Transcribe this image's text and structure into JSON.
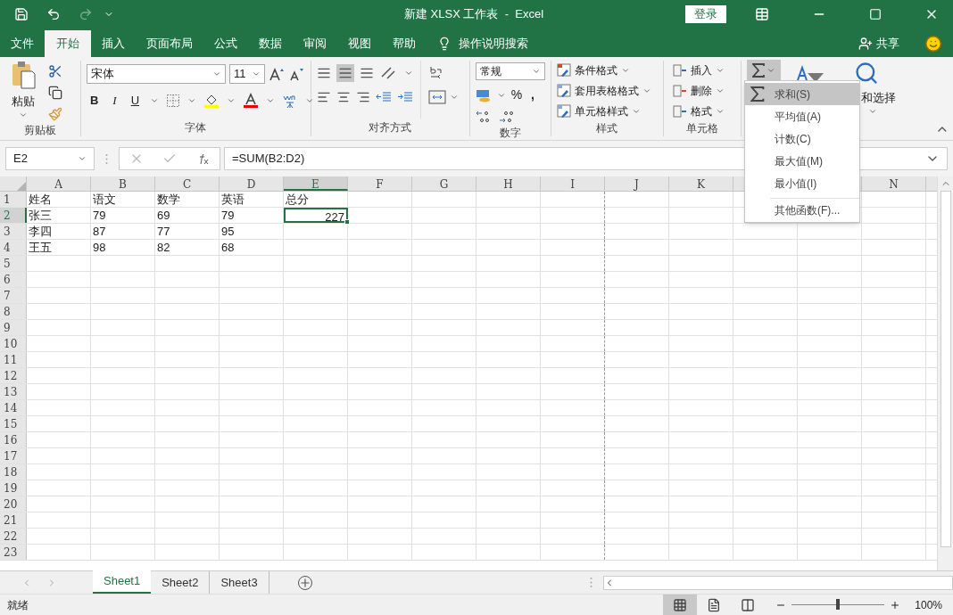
{
  "title_bar": {
    "title": "新建 XLSX 工作表  -  Excel",
    "login_button": "登录"
  },
  "menu_tabs": [
    {
      "label": "文件",
      "selected": false
    },
    {
      "label": "开始",
      "selected": true
    },
    {
      "label": "插入",
      "selected": false
    },
    {
      "label": "页面布局",
      "selected": false
    },
    {
      "label": "公式",
      "selected": false
    },
    {
      "label": "数据",
      "selected": false
    },
    {
      "label": "审阅",
      "selected": false
    },
    {
      "label": "视图",
      "selected": false
    },
    {
      "label": "帮助",
      "selected": false
    }
  ],
  "tell_me": "操作说明搜索",
  "share": "共享",
  "ribbon": {
    "clipboard": {
      "paste": "粘贴",
      "label": "剪贴板"
    },
    "font": {
      "name": "宋体",
      "size": "11",
      "bold": "B",
      "italic": "I",
      "underline": "U",
      "label": "字体"
    },
    "alignment": {
      "label": "对齐方式"
    },
    "number": {
      "format": "常规",
      "percent": "%",
      "comma": ",",
      "label": "数字"
    },
    "styles": {
      "items": [
        "条件格式",
        "套用表格格式",
        "单元格样式"
      ],
      "label": "样式"
    },
    "cells": {
      "items": [
        "插入",
        "删除",
        "格式"
      ],
      "label": "单元格"
    },
    "editing": {
      "find": "和选择",
      "sum_open": true
    }
  },
  "sum_menu": [
    {
      "label": "求和(S)",
      "selected": true,
      "kind": "sum"
    },
    {
      "label": "平均值(A)",
      "selected": false,
      "kind": "plain"
    },
    {
      "label": "计数(C)",
      "selected": false,
      "kind": "plain"
    },
    {
      "label": "最大值(M)",
      "selected": false,
      "kind": "plain"
    },
    {
      "label": "最小值(I)",
      "selected": false,
      "kind": "plain"
    },
    {
      "label": "其他函数(F)...",
      "selected": false,
      "kind": "more"
    }
  ],
  "formula_bar": {
    "name_box": "E2",
    "formula": "=SUM(B2:D2)"
  },
  "sheet": {
    "columns": [
      {
        "label": "A",
        "selected": false
      },
      {
        "label": "B",
        "selected": false
      },
      {
        "label": "C",
        "selected": false
      },
      {
        "label": "D",
        "selected": false
      },
      {
        "label": "E",
        "selected": true
      },
      {
        "label": "F",
        "selected": false
      },
      {
        "label": "G",
        "selected": false
      },
      {
        "label": "H",
        "selected": false
      },
      {
        "label": "I",
        "selected": false
      },
      {
        "label": "J",
        "selected": false
      },
      {
        "label": "K",
        "selected": false
      },
      null,
      null,
      {
        "label": "N",
        "selected": false
      }
    ],
    "rows": [
      {
        "header": "1",
        "selected": false,
        "cells": [
          {
            "text": "姓名",
            "kind": "text"
          },
          {
            "text": "语文",
            "kind": "text"
          },
          {
            "text": "数学",
            "kind": "text"
          },
          {
            "text": "英语",
            "kind": "text"
          },
          {
            "text": "总分",
            "kind": "text"
          }
        ]
      },
      {
        "header": "2",
        "selected": true,
        "cells": [
          {
            "text": "张三",
            "kind": "text"
          },
          {
            "text": "79",
            "kind": "text"
          },
          {
            "text": "69",
            "kind": "text"
          },
          {
            "text": "79",
            "kind": "text"
          },
          {
            "text": "227",
            "kind": "number"
          }
        ]
      },
      {
        "header": "3",
        "selected": false,
        "cells": [
          {
            "text": "李四",
            "kind": "text"
          },
          {
            "text": "87",
            "kind": "text"
          },
          {
            "text": "77",
            "kind": "text"
          },
          {
            "text": "95",
            "kind": "text"
          }
        ]
      },
      {
        "header": "4",
        "selected": false,
        "cells": [
          {
            "text": "王五",
            "kind": "text"
          },
          {
            "text": "98",
            "kind": "text"
          },
          {
            "text": "82",
            "kind": "text"
          },
          {
            "text": "68",
            "kind": "text"
          }
        ]
      },
      {
        "header": "5",
        "selected": false
      },
      {
        "header": "6",
        "selected": false
      },
      {
        "header": "7",
        "selected": false
      },
      {
        "header": "8",
        "selected": false
      },
      {
        "header": "9",
        "selected": false
      },
      {
        "header": "10",
        "selected": false
      },
      {
        "header": "11",
        "selected": false
      },
      {
        "header": "12",
        "selected": false
      },
      {
        "header": "13",
        "selected": false
      },
      {
        "header": "14",
        "selected": false
      },
      {
        "header": "15",
        "selected": false
      },
      {
        "header": "16",
        "selected": false
      },
      {
        "header": "17",
        "selected": false
      },
      {
        "header": "18",
        "selected": false
      },
      {
        "header": "19",
        "selected": false
      },
      {
        "header": "20",
        "selected": false
      },
      {
        "header": "21",
        "selected": false
      },
      {
        "header": "22",
        "selected": false
      },
      {
        "header": "23",
        "selected": false
      }
    ]
  },
  "sheet_tabs": [
    {
      "label": "Sheet1",
      "selected": true
    },
    {
      "label": "Sheet2",
      "selected": false
    },
    {
      "label": "Sheet3",
      "selected": false
    }
  ],
  "status_bar": {
    "status": "就绪",
    "views": [
      {
        "kind": "normal",
        "selected": true
      },
      {
        "kind": "layout",
        "selected": false
      },
      {
        "kind": "break",
        "selected": false
      }
    ],
    "zoom": {
      "level": 0.5,
      "reading": "100%"
    }
  }
}
